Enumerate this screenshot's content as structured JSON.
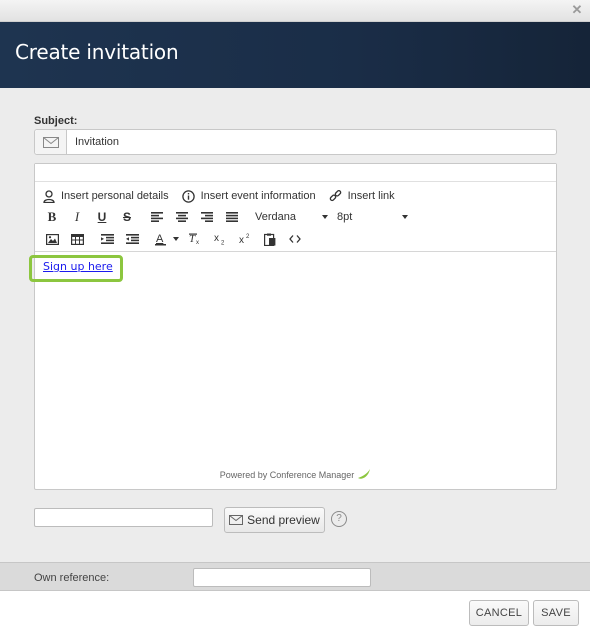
{
  "window": {
    "close_icon": "close-icon"
  },
  "header": {
    "title": "Create invitation",
    "background_color": "#1c3049"
  },
  "subject": {
    "label": "Subject:",
    "value": "Invitation",
    "icon": "envelope-icon"
  },
  "editor": {
    "insert_links": [
      {
        "label": "Insert personal details",
        "icon": "person-icon"
      },
      {
        "label": "Insert event information",
        "icon": "info-icon"
      },
      {
        "label": "Insert link",
        "icon": "link-icon"
      }
    ],
    "formatting_buttons": [
      "bold-icon",
      "italic-icon",
      "underline-icon",
      "strikethrough-icon",
      "align-left-icon",
      "align-center-icon",
      "align-right-icon",
      "align-justify-icon"
    ],
    "font_family": "Verdana",
    "font_size": "8pt",
    "insert_buttons": [
      "image-icon",
      "table-icon",
      "outdent-icon",
      "indent-icon",
      "text-color-icon",
      "clear-format-icon",
      "subscript-icon",
      "superscript-icon",
      "paste-icon",
      "source-code-icon"
    ],
    "content": {
      "link_text": "Sign up here",
      "highlight_color": "#8cc63f",
      "link_color": "#1a1aee"
    },
    "powered_by": "Powered by Conference Manager"
  },
  "preview": {
    "input_value": "",
    "send_label": "Send preview",
    "help_label": "?"
  },
  "own_reference": {
    "label": "Own reference:",
    "value": ""
  },
  "footer": {
    "cancel_label": "CANCEL",
    "save_label": "SAVE"
  }
}
